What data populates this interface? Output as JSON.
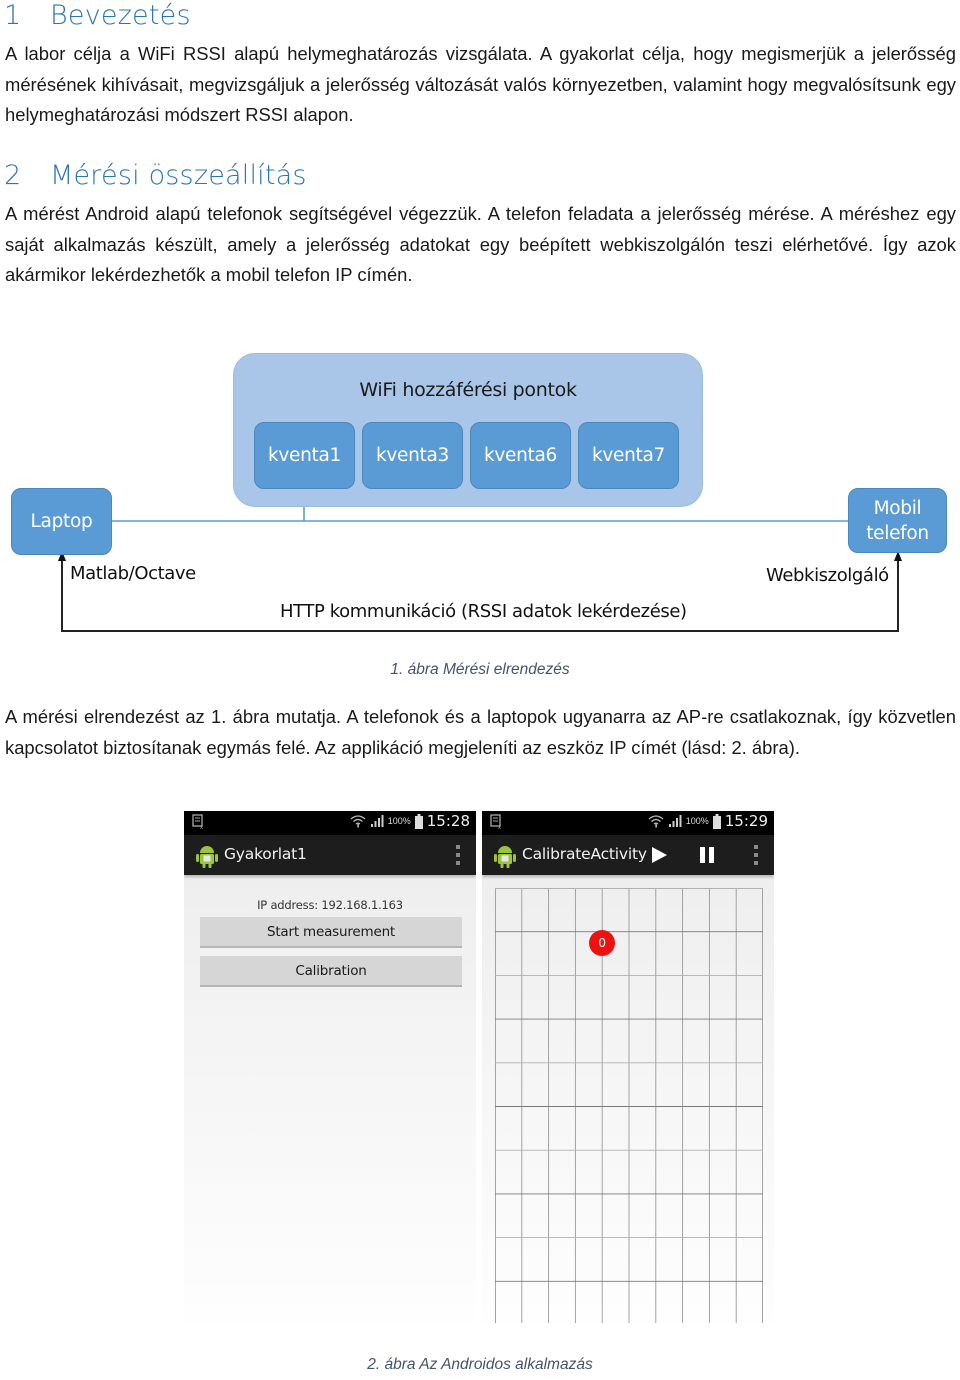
{
  "sections": [
    {
      "number": "1",
      "title": "Bevezetés",
      "paragraph": "A labor célja a WiFi RSSI alapú helymeghatározás vizsgálata. A gyakorlat célja, hogy megismerjük a jelerősség mérésének kihívásait, megvizsgáljuk a jelerősség változását valós környezetben, valamint hogy megvalósítsunk egy helymeghatározási módszert RSSI alapon."
    },
    {
      "number": "2",
      "title": "Mérési összeállítás",
      "paragraph": "A mérést Android alapú telefonok segítségével végezzük. A telefon feladata a jelerősség mérése. A méréshez egy saját alkalmazás készült, amely a jelerősség adatokat egy beépített webkiszolgálón teszi elérhetővé. Így azok akármikor lekérdezhetők a mobil telefon IP címén."
    }
  ],
  "figure1": {
    "group_title": "WiFi hozzáférési pontok",
    "access_points": [
      "kventa1",
      "kventa3",
      "kventa6",
      "kventa7"
    ],
    "laptop": "Laptop",
    "mobile": "Mobil telefon",
    "laptop_label": "Matlab/Octave",
    "mobile_label": "Webkiszolgáló",
    "link_label": "HTTP kommunikáció (RSSI adatok lekérdezése)",
    "caption": "1. ábra Mérési elrendezés",
    "colors": {
      "group": "#a9c6e8",
      "node": "#5b9bd5",
      "line": "#5b9bd5"
    }
  },
  "paragraph3": "A mérési elrendezést az 1. ábra mutatja. A telefonok és a laptopok ugyanarra az AP-re csatlakoznak, így közvetlen kapcsolatot biztosítanak egymás felé. Az applikáció megjeleníti az eszköz IP címét (lásd: 2. ábra).",
  "figure2": {
    "phone1": {
      "battery": "100%",
      "time": "15:28",
      "app_title": "Gyakorlat1",
      "ip_label": "IP address: 192.168.1.163",
      "buttons": [
        "Start measurement",
        "Calibration"
      ]
    },
    "phone2": {
      "battery": "100%",
      "time": "15:29",
      "app_title": "CalibrateActivity",
      "grid": {
        "columns": 10,
        "rows": 10
      },
      "marker": {
        "label": "0",
        "col_line": 4,
        "row_line": 1,
        "color": "#ee1111"
      }
    },
    "caption": "2. ábra Az Androidos alkalmazás"
  }
}
